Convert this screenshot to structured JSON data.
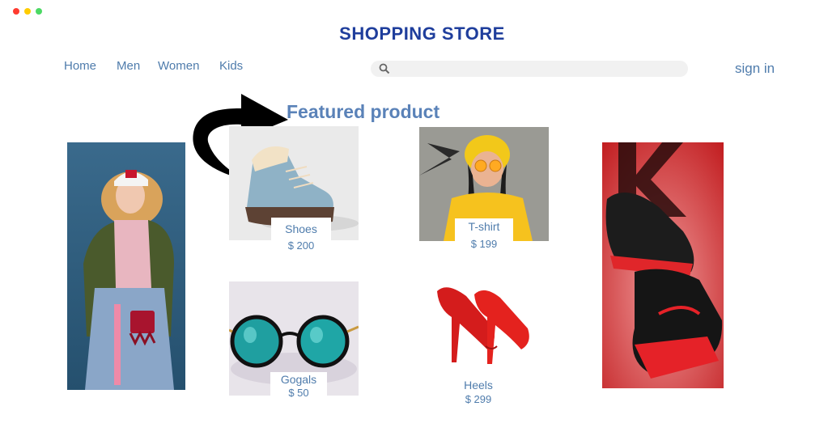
{
  "window": {
    "controls": [
      "close",
      "minimize",
      "maximize"
    ]
  },
  "colors": {
    "title": "#1f3e9c",
    "nav": "#4f7cac",
    "accent": "#5a82b8",
    "dot_red": "#ff3b30",
    "dot_yellow": "#ffcc00",
    "dot_green": "#4cd964"
  },
  "header": {
    "title": "SHOPPING STORE"
  },
  "nav": {
    "items": [
      {
        "label": "Home"
      },
      {
        "label": "Men"
      },
      {
        "label": "Women"
      },
      {
        "label": "Kids"
      }
    ]
  },
  "search": {
    "placeholder": "",
    "icon": "search-icon"
  },
  "account": {
    "sign_in": "sign in"
  },
  "featured": {
    "heading": "Featured product",
    "arrow_icon": "curved-arrow-icon"
  },
  "products": [
    {
      "name": "Shoes",
      "price": "$ 200"
    },
    {
      "name": "T-shirt",
      "price": "$ 199"
    },
    {
      "name": "Gogals",
      "price": "$ 50"
    },
    {
      "name": "Heels",
      "price": "$ 299"
    }
  ],
  "banners": {
    "left": "fashion-model-photo",
    "right": "sneaker-photo"
  }
}
